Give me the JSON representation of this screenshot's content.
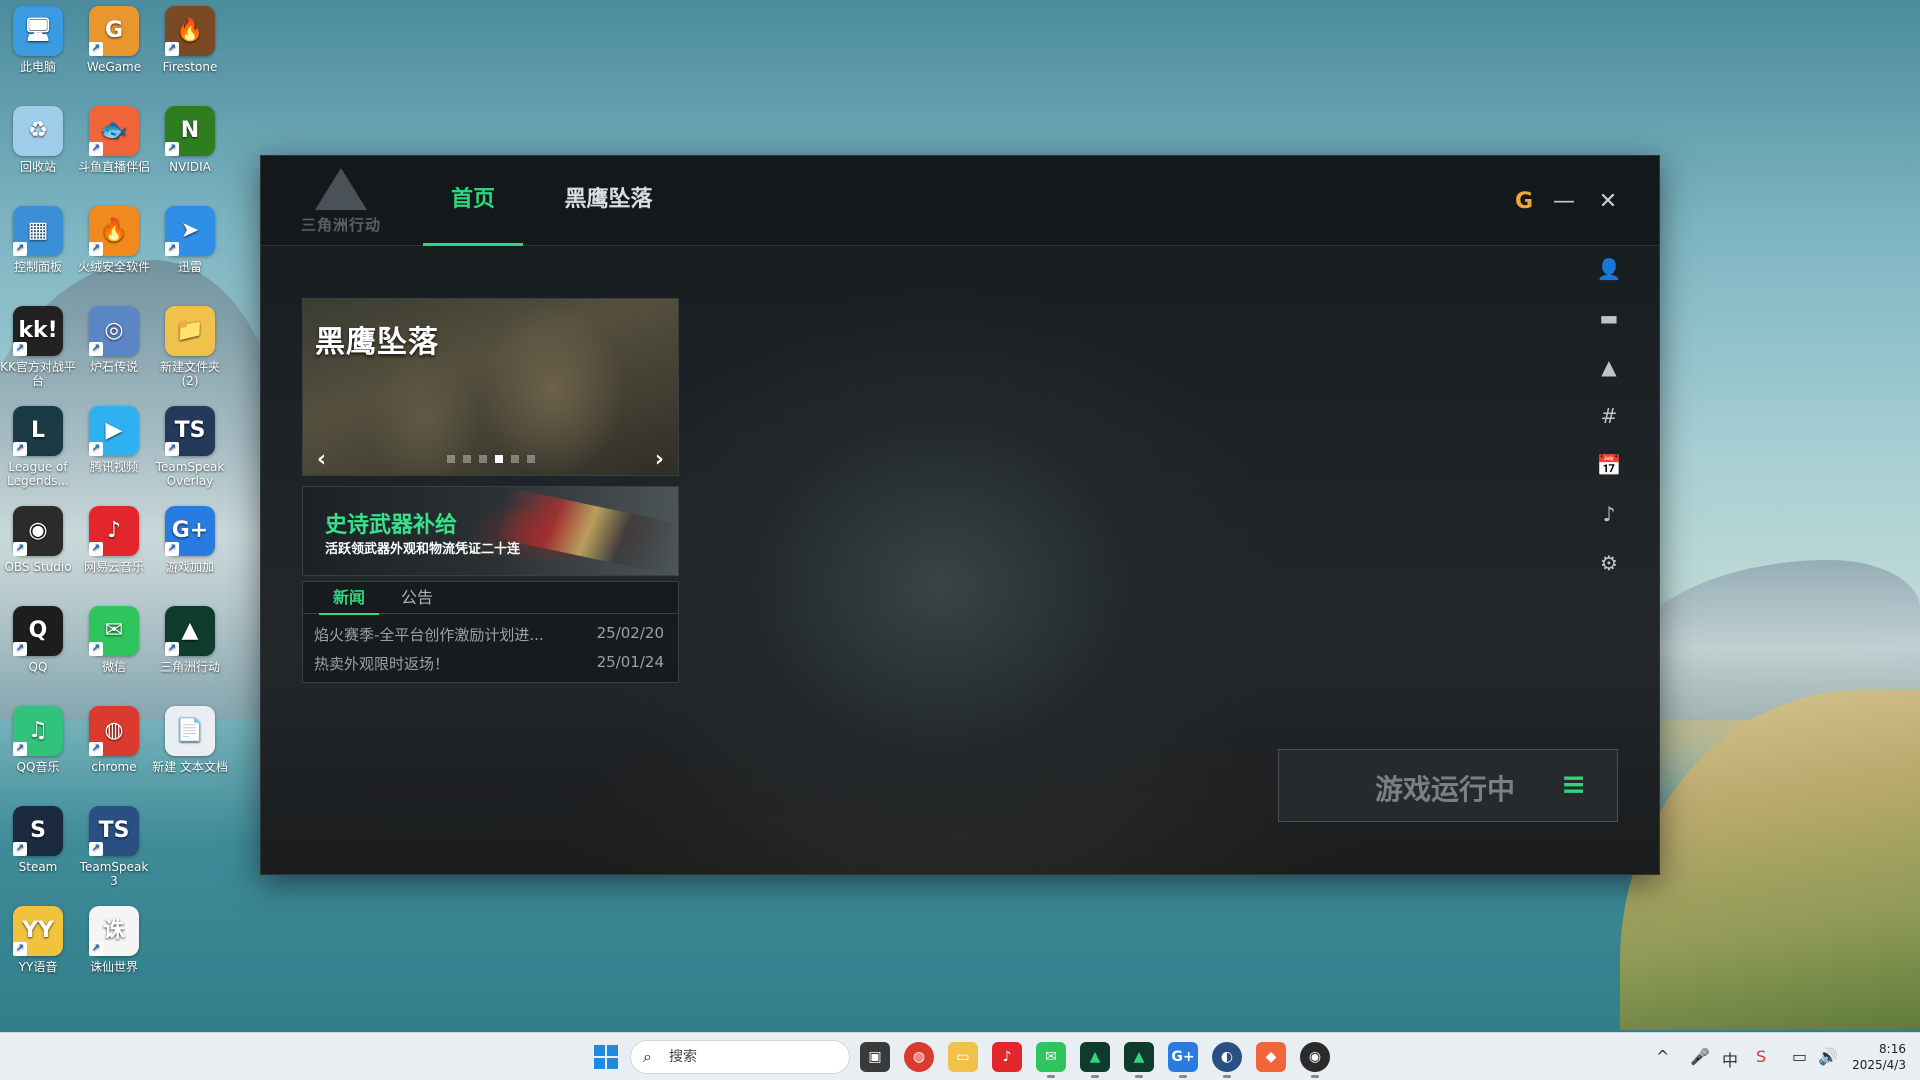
{
  "desktop": {
    "icons": [
      {
        "label": "此电脑",
        "glyph": "🖥",
        "color": "#3a9be0"
      },
      {
        "label": "WeGame",
        "glyph": "G",
        "color": "#e8962e"
      },
      {
        "label": "Firestone",
        "glyph": "🔥",
        "color": "#7a4a24"
      },
      {
        "label": "回收站",
        "glyph": "♻",
        "color": "#9fcde9"
      },
      {
        "label": "斗鱼直播伴侣",
        "glyph": "🐟",
        "color": "#f0663a"
      },
      {
        "label": "NVIDIA",
        "glyph": "N",
        "color": "#2e7d1e"
      },
      {
        "label": "控制面板",
        "glyph": "▦",
        "color": "#3b8fd6"
      },
      {
        "label": "火绒安全软件",
        "glyph": "🔥",
        "color": "#f08a1c"
      },
      {
        "label": "迅雷",
        "glyph": "➤",
        "color": "#2f8fe8"
      },
      {
        "label": "KK官方对战平台",
        "glyph": "kk!",
        "color": "#222222"
      },
      {
        "label": "炉石传说",
        "glyph": "◎",
        "color": "#5b86c6"
      },
      {
        "label": "新建文件夹 (2)",
        "glyph": "📁",
        "color": "#f1c24b"
      },
      {
        "label": "League of Legends...",
        "glyph": "L",
        "color": "#1a3b45"
      },
      {
        "label": "腾讯视频",
        "glyph": "▶",
        "color": "#2fb0f0"
      },
      {
        "label": "TeamSpeak Overlay",
        "glyph": "TS",
        "color": "#233a5a"
      },
      {
        "label": "OBS Studio",
        "glyph": "◉",
        "color": "#2b2b2b"
      },
      {
        "label": "网易云音乐",
        "glyph": "♪",
        "color": "#e3262c"
      },
      {
        "label": "游戏加加",
        "glyph": "G+",
        "color": "#2a7be0"
      },
      {
        "label": "QQ",
        "glyph": "Q",
        "color": "#1d1d1d"
      },
      {
        "label": "微信",
        "glyph": "✉",
        "color": "#2fc45e"
      },
      {
        "label": "三角洲行动",
        "glyph": "▲",
        "color": "#0e3b2c"
      },
      {
        "label": "QQ音乐",
        "glyph": "♫",
        "color": "#31c27c"
      },
      {
        "label": "chrome",
        "glyph": "◍",
        "color": "#db3b2f"
      },
      {
        "label": "新建 文本文档",
        "glyph": "📄",
        "color": "#e9eef2"
      },
      {
        "label": "Steam",
        "glyph": "S",
        "color": "#1b2a3f"
      },
      {
        "label": "TeamSpeak 3",
        "glyph": "TS",
        "color": "#2a4f82"
      },
      {
        "label": "",
        "glyph": "",
        "color": "#00000000"
      },
      {
        "label": "YY语音",
        "glyph": "YY",
        "color": "#f1c33c"
      },
      {
        "label": "诛仙世界",
        "glyph": "诛",
        "color": "#f5f5f5"
      }
    ]
  },
  "app": {
    "logo_text": "三角洲行动",
    "tabs": [
      {
        "label": "首页",
        "active": true
      },
      {
        "label": "黑鹰坠落",
        "active": false
      }
    ],
    "header_buttons": {
      "wegame": "G",
      "minimize": "—",
      "close": "✕"
    },
    "rail": [
      "👤",
      "▬",
      "▲",
      "#",
      "📅",
      "♪",
      "⚙"
    ],
    "banner": {
      "title": "黑鹰坠落",
      "prev": "‹",
      "next": "›",
      "dots": 6,
      "active_dot": 3
    },
    "promo": {
      "title": "史诗武器补给",
      "subtitle": "活跃领武器外观和物流凭证二十连"
    },
    "news": {
      "tabs": [
        "新闻",
        "公告"
      ],
      "items": [
        {
          "title": "焰火赛季-全平台创作激励计划进...",
          "date": "25/02/20"
        },
        {
          "title": "热卖外观限时返场！",
          "date": "25/01/24"
        }
      ]
    },
    "status": {
      "text": "游戏运行中",
      "menu": "≡"
    }
  },
  "taskbar": {
    "search_placeholder": "搜索",
    "tray": [
      "^",
      "🎤",
      "中",
      "S",
      "▭",
      "🔊"
    ],
    "time": "8:16",
    "date": "2025/4/3"
  },
  "colors": {
    "accent": "#2fd67e",
    "wegame": "#f0a43a"
  }
}
